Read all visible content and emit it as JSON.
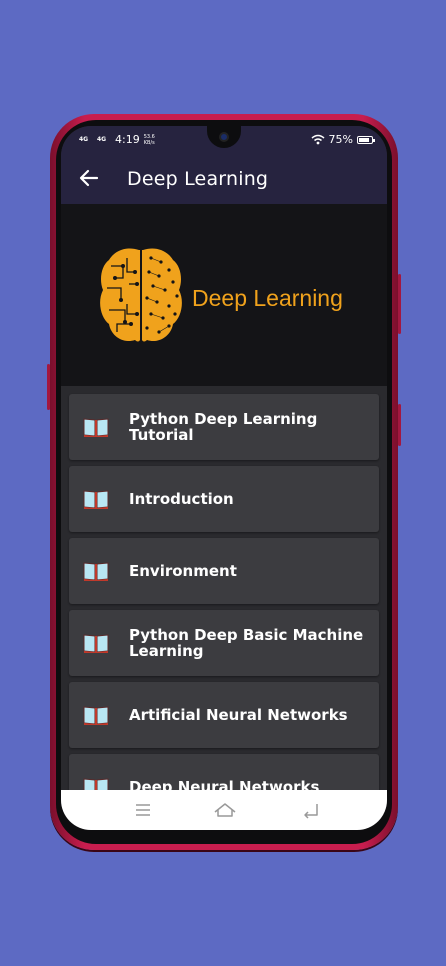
{
  "status": {
    "network": "4G",
    "time": "4:19",
    "speed": "53.6",
    "speed_unit": "KB/s",
    "battery": "75%"
  },
  "app_bar": {
    "title": "Deep Learning",
    "back_icon": "arrow-left-icon"
  },
  "banner": {
    "text": "Deep Learning",
    "accent": "#f0a21c"
  },
  "list": {
    "items": [
      {
        "label": "Python Deep Learning Tutorial",
        "icon": "book-icon"
      },
      {
        "label": "Introduction",
        "icon": "book-icon"
      },
      {
        "label": "Environment",
        "icon": "book-icon"
      },
      {
        "label": "Python Deep Basic Machine Learning",
        "icon": "book-icon"
      },
      {
        "label": "Artificial Neural Networks",
        "icon": "book-icon"
      },
      {
        "label": "Deep Neural Networks",
        "icon": "book-icon"
      }
    ]
  },
  "nav_bar": {
    "menu_icon": "menu-icon",
    "home_icon": "home-icon",
    "back_icon": "back-icon"
  },
  "colors": {
    "background": "#5d6ac3",
    "app_bar": "#26233f",
    "banner_bg": "#141417",
    "list_item": "#3c3c40",
    "phone_frame": "#c81d4e"
  }
}
